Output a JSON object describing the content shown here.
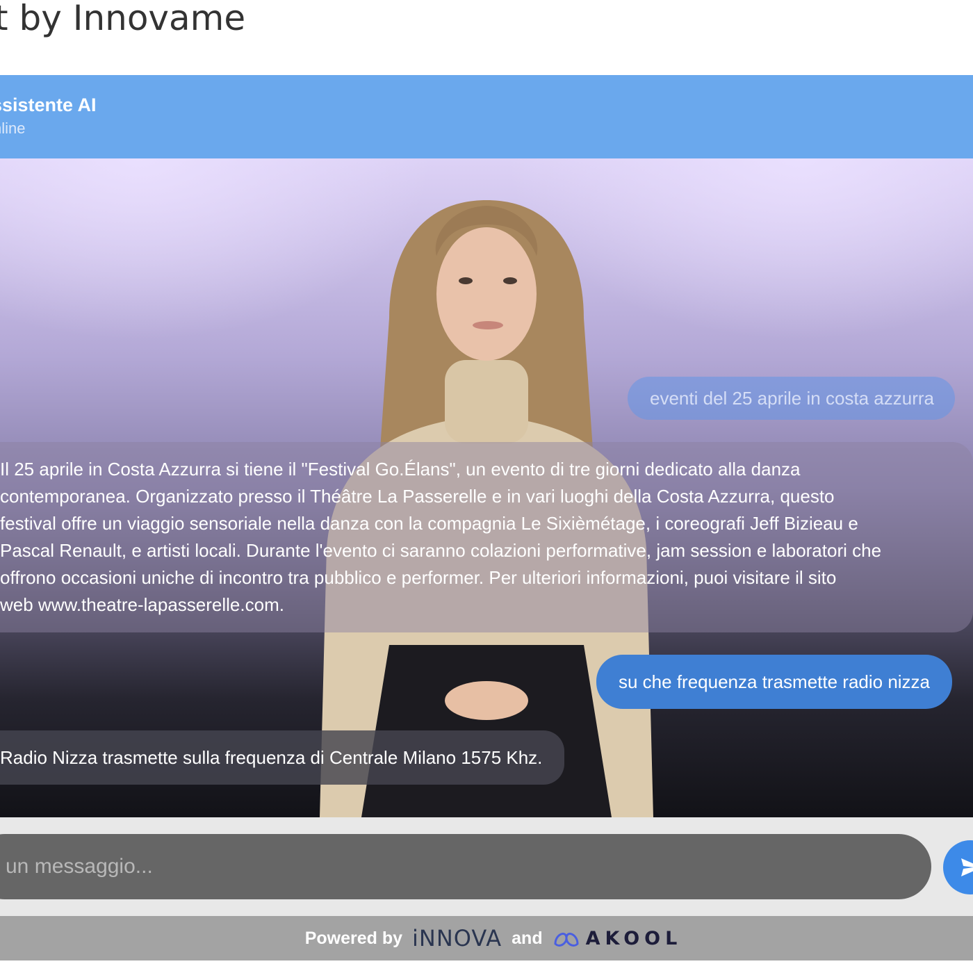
{
  "page": {
    "title": "t by Innovame"
  },
  "header": {
    "name": "ssistente AI",
    "status": "nline"
  },
  "messages": [
    {
      "role": "user",
      "text": "eventi del 25 aprile in costa azzurra",
      "faded": true
    },
    {
      "role": "assistant",
      "lines": [
        "Il 25 aprile in Costa Azzurra si tiene il \"Festival Go.Élans\", un evento di tre giorni dedicato alla danza",
        "contemporanea. Organizzato presso il Théâtre La Passerelle e in vari luoghi della Costa Azzurra, questo",
        "festival offre un viaggio sensoriale nella danza con la compagnia Le Sixièmétage, i coreografi Jeff Bizieau e",
        "Pascal Renault, e artisti locali. Durante l'evento ci saranno colazioni performative, jam session e laboratori che",
        "offrono occasioni uniche di incontro tra pubblico e performer. Per ulteriori informazioni, puoi visitare il sito",
        "web www.theatre-lapasserelle.com."
      ]
    },
    {
      "role": "user",
      "text": "su che frequenza trasmette radio nizza"
    },
    {
      "role": "assistant",
      "text": "Radio Nizza trasmette sulla frequenza di Centrale Milano 1575 Khz."
    }
  ],
  "input": {
    "placeholder": "un messaggio..."
  },
  "send_button": {
    "icon": "send-icon"
  },
  "footer": {
    "powered_by": "Powered by",
    "brand1": "iNNOVA",
    "and": "and",
    "brand2": "AKOOL"
  },
  "colors": {
    "header": "#6aa8ed",
    "user_bubble": "#3f7fd3",
    "send_button": "#3d8ae8",
    "footer": "#a3a3a3"
  }
}
